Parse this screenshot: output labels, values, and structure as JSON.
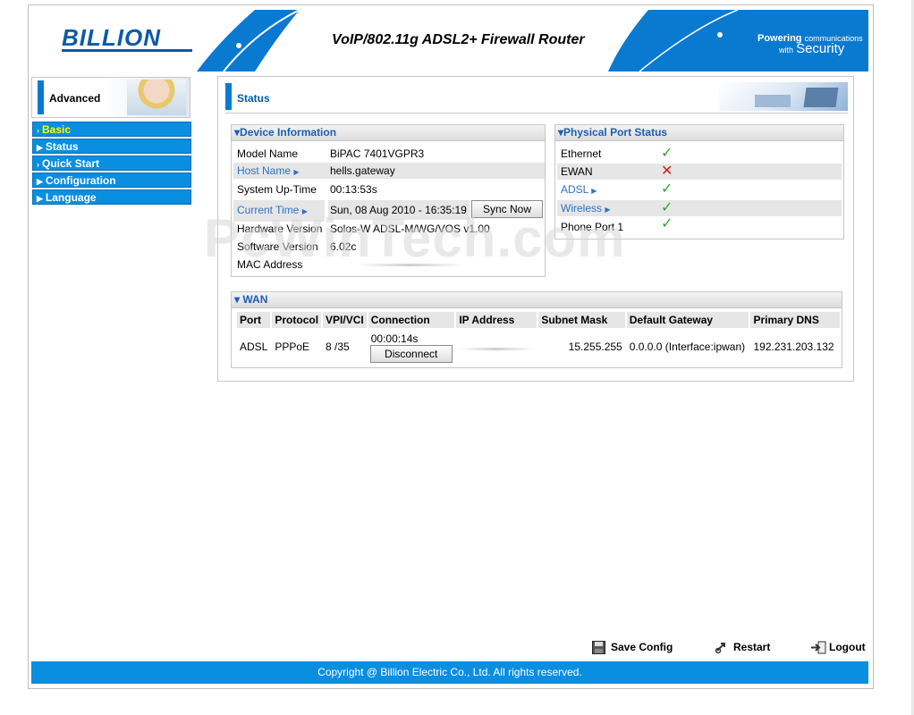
{
  "header": {
    "brand": "BILLION",
    "title": "VoIP/802.11g ADSL2+ Firewall Router",
    "tagline_line1": "Powering",
    "tagline_small1": "communications",
    "tagline_small2": "with",
    "tagline_line2": "Security"
  },
  "sidebar": {
    "card_label": "Advanced",
    "items": [
      {
        "label": "Basic"
      },
      {
        "label": "Status"
      },
      {
        "label": "Quick Start"
      },
      {
        "label": "Configuration"
      },
      {
        "label": "Language"
      }
    ]
  },
  "page": {
    "title": "Status"
  },
  "device_info": {
    "title": "Device Information",
    "model_name_label": "Model Name",
    "model_name": "BiPAC 7401VGPR3",
    "host_name_label": "Host Name",
    "host_name": "hells.gateway",
    "uptime_label": "System Up-Time",
    "uptime": "00:13:53s",
    "current_time_label": "Current Time",
    "current_time": "Sun, 08 Aug 2010 - 16:35:19",
    "sync_button": "Sync Now",
    "hw_version_label": "Hardware Version",
    "hw_version": "Solos-W ADSL-M/WG/VOS v1.00",
    "sw_version_label": "Software Version",
    "sw_version": "6.02c",
    "mac_label": "MAC Address",
    "mac": ""
  },
  "port_status": {
    "title": "Physical Port Status",
    "ports": [
      {
        "name": "Ethernet",
        "status": "up"
      },
      {
        "name": "EWAN",
        "status": "down"
      },
      {
        "name": "ADSL",
        "status": "up"
      },
      {
        "name": "Wireless",
        "status": "up"
      },
      {
        "name": "Phone Port 1",
        "status": "up"
      }
    ]
  },
  "wan": {
    "title": "WAN",
    "headers": [
      "Port",
      "Protocol",
      "VPI/VCI",
      "Connection",
      "IP Address",
      "Subnet Mask",
      "Default Gateway",
      "Primary DNS"
    ],
    "row": {
      "port": "ADSL",
      "protocol": "PPPoE",
      "vpi_vci": "8  /35",
      "connection_time": "00:00:14s",
      "disconnect_button": "Disconnect",
      "ip_address": "",
      "subnet_mask": "15.255.255",
      "gateway": "0.0.0.0  (Interface:ipwan)",
      "dns": "192.231.203.132"
    }
  },
  "watermark": "PcWinTech.com",
  "actions": {
    "save": "Save Config",
    "restart": "Restart",
    "logout": "Logout"
  },
  "footer": {
    "copyright": "Copyright @ Billion Electric Co., Ltd. All rights reserved."
  },
  "colors": {
    "accent": "#0a8ee0",
    "link": "#2a72c8",
    "ok": "#2aa62a",
    "error": "#d31b1b",
    "menu_active": "#ffff00"
  }
}
